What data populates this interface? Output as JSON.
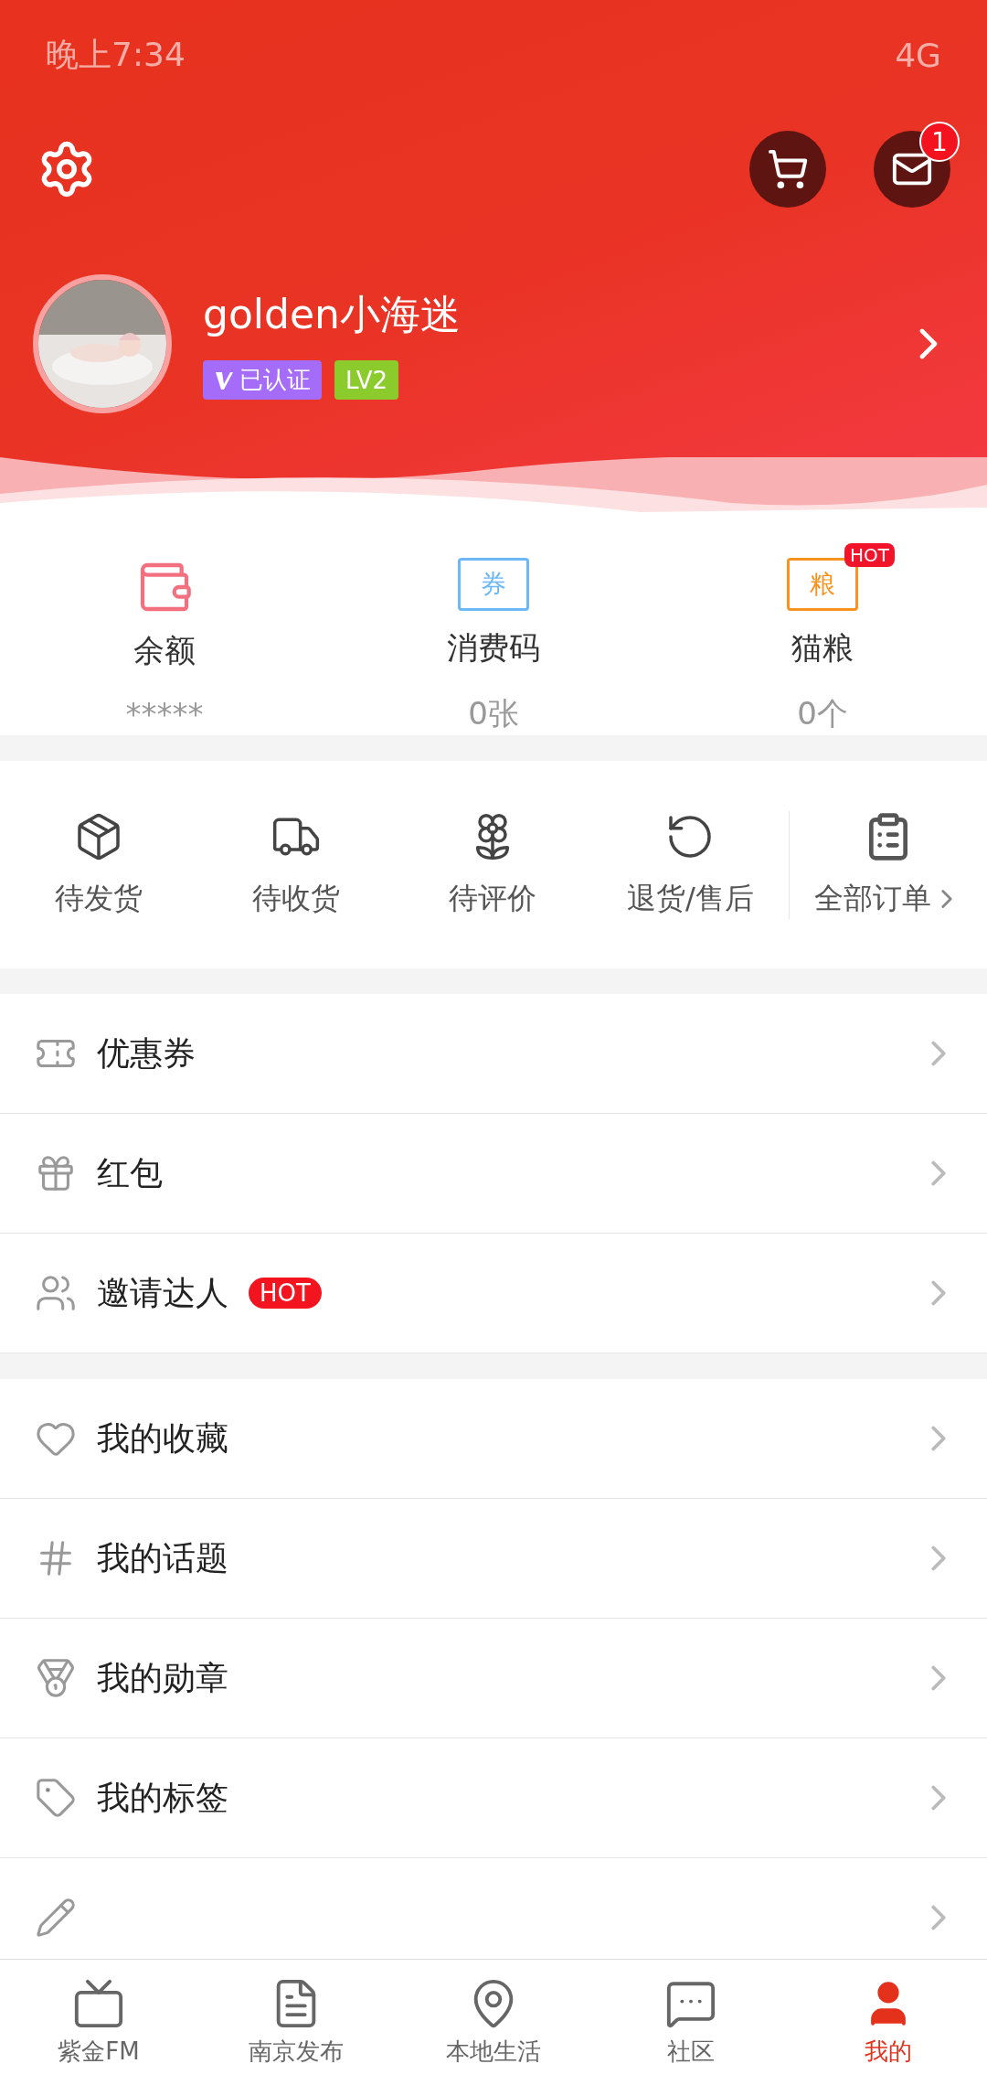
{
  "status_bar": {
    "time": "晚上7:34",
    "network": "4G"
  },
  "header": {
    "message_count": "1"
  },
  "profile": {
    "name": "golden小海迷",
    "verified": "已认证",
    "level_badge": "LV2"
  },
  "stats": [
    {
      "label": "余额",
      "value": "*****"
    },
    {
      "label": "消费码",
      "value": "0张",
      "icon_text": "券"
    },
    {
      "label": "猫粮",
      "value": "0个",
      "icon_text": "粮",
      "badge": "HOT"
    }
  ],
  "orders": [
    {
      "label": "待发货"
    },
    {
      "label": "待收货"
    },
    {
      "label": "待评价"
    },
    {
      "label": "退货/售后"
    }
  ],
  "all_orders": {
    "label": "全部订单"
  },
  "menu_groups": [
    [
      {
        "label": "优惠券"
      },
      {
        "label": "红包"
      },
      {
        "label": "邀请达人",
        "badge": "HOT"
      }
    ],
    [
      {
        "label": "我的收藏"
      },
      {
        "label": "我的话题"
      },
      {
        "label": "我的勋章"
      },
      {
        "label": "我的标签"
      }
    ]
  ],
  "tabs": [
    {
      "label": "紫金FM",
      "selected": false
    },
    {
      "label": "南京发布",
      "selected": false
    },
    {
      "label": "本地生活",
      "selected": false
    },
    {
      "label": "社区",
      "selected": false
    },
    {
      "label": "我的",
      "selected": true
    }
  ]
}
